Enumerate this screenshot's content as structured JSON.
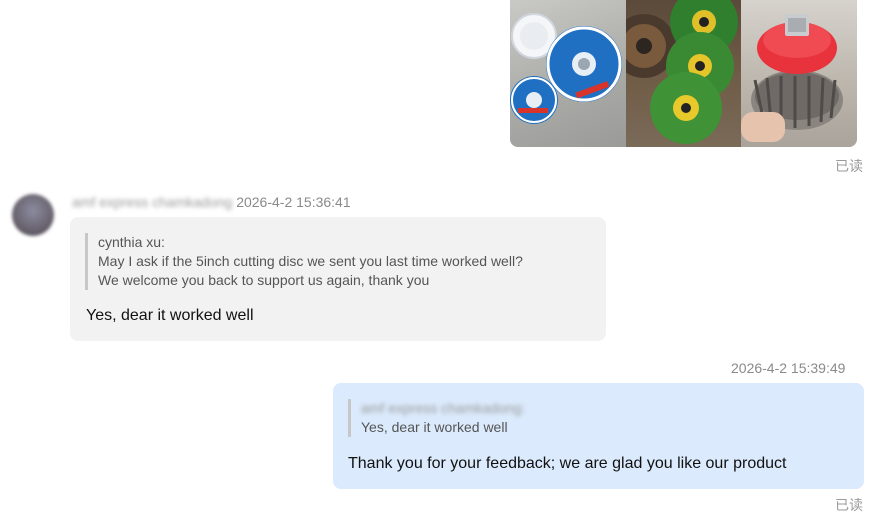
{
  "message_1": {
    "read_status": "已读"
  },
  "message_2": {
    "sender": "amf express chamkadong",
    "timestamp": "2026-4-2 15:36:41",
    "quote_author": "cynthia xu:",
    "quote_lines": [
      "May I ask if the 5inch cutting disc we sent you last time worked well?",
      "We welcome you back to support us again, thank you"
    ],
    "text": "Yes, dear it worked well"
  },
  "message_3": {
    "timestamp": "2026-4-2 15:39:49",
    "quote_author": "amf express chamkadong:",
    "quote_text": "Yes, dear it worked well",
    "text": "Thank you for your feedback; we are glad you like our product",
    "read_status": "已读"
  },
  "colors": {
    "incoming_bubble": "#f2f2f2",
    "outgoing_bubble": "#dbeafc",
    "meta_text": "#8a8a8a",
    "quote_bar": "#c7c7c7"
  }
}
